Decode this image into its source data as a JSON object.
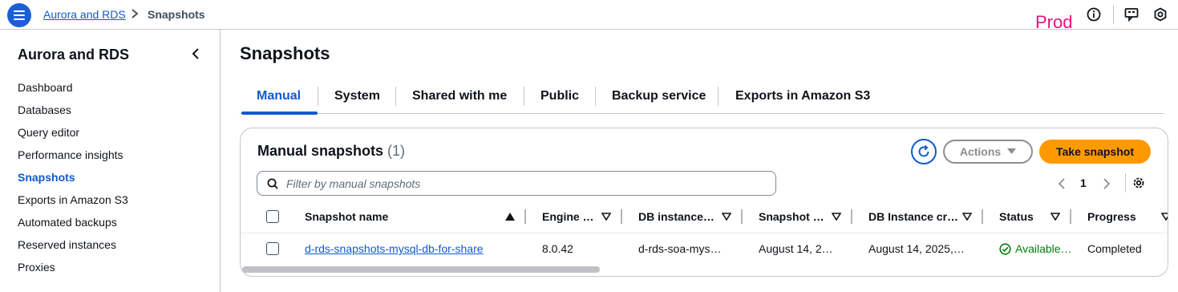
{
  "breadcrumb": {
    "parent": "Aurora and RDS",
    "current": "Snapshots"
  },
  "environment": {
    "label": "Prod",
    "color": "#e8107f"
  },
  "sidebar": {
    "title": "Aurora and RDS",
    "items": [
      {
        "label": "Dashboard"
      },
      {
        "label": "Databases"
      },
      {
        "label": "Query editor"
      },
      {
        "label": "Performance insights"
      },
      {
        "label": "Snapshots",
        "active": true
      },
      {
        "label": "Exports in Amazon S3"
      },
      {
        "label": "Automated backups"
      },
      {
        "label": "Reserved instances"
      },
      {
        "label": "Proxies"
      }
    ]
  },
  "page": {
    "title": "Snapshots"
  },
  "tabs": [
    {
      "label": "Manual",
      "active": true
    },
    {
      "label": "System"
    },
    {
      "label": "Shared with me"
    },
    {
      "label": "Public"
    },
    {
      "label": "Backup service"
    },
    {
      "label": "Exports in Amazon S3"
    }
  ],
  "panel": {
    "title": "Manual snapshots",
    "count": "(1)",
    "actions_label": "Actions",
    "take_snapshot_label": "Take snapshot",
    "filter_placeholder": "Filter by manual snapshots",
    "page_number": "1"
  },
  "table": {
    "columns": [
      "Snapshot name",
      "Engine …",
      "DB instance…",
      "Snapshot …",
      "DB Instance cr…",
      "Status",
      "Progress"
    ],
    "rows": [
      {
        "snapshot_name": "d-rds-snapshots-mysql-db-for-share",
        "engine": "8.0.42",
        "db_instance": "d-rds-soa-mys…",
        "snapshot_time": "August 14, 2…",
        "db_instance_created": "August 14, 2025,…",
        "status": "Available…",
        "progress": "Completed"
      }
    ]
  },
  "colors": {
    "accent": "#0f5ad0",
    "primary_button": "#ff9900",
    "success": "#037f0c"
  }
}
